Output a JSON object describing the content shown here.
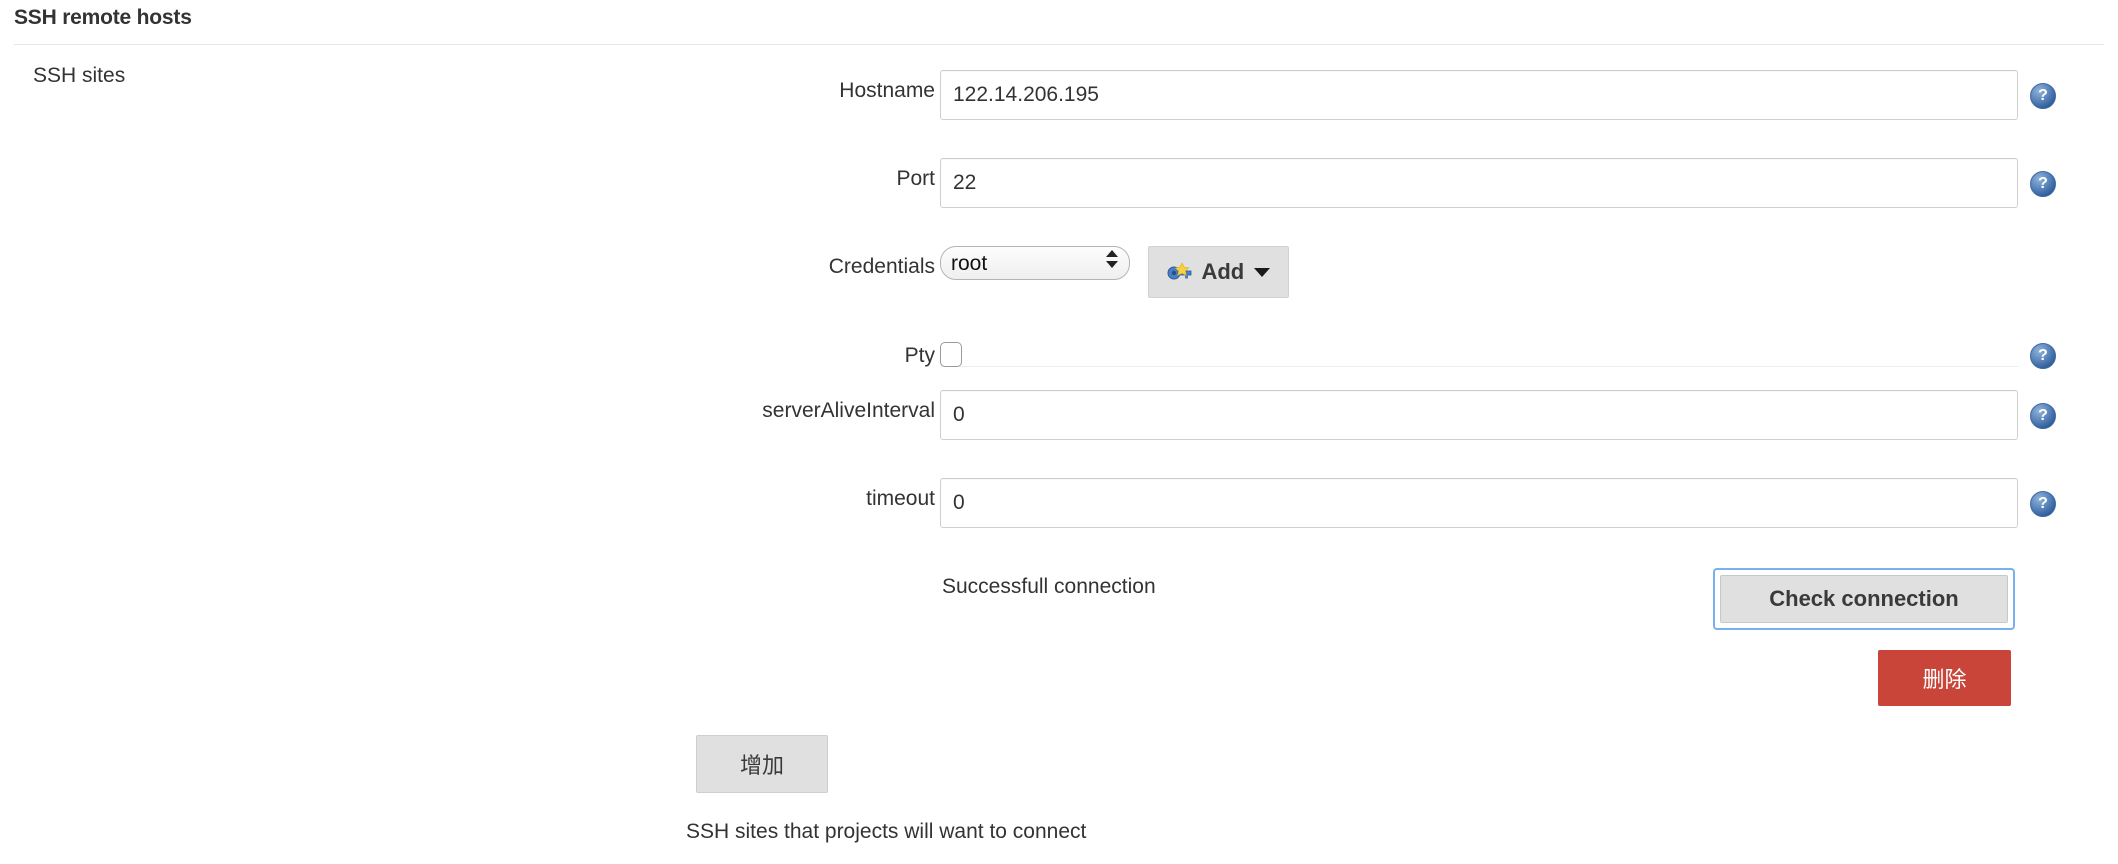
{
  "header": {
    "title": "SSH remote hosts"
  },
  "section": {
    "label": "SSH sites"
  },
  "colors": {
    "delete_button_bg": "#c9453a",
    "focus_ring": "#7ab0ef",
    "help_icon_blue": "#2f5c99",
    "button_bg": "#e0e0e0",
    "divider": "#e6e6e6"
  },
  "fields": {
    "hostname": {
      "label": "Hostname",
      "value": "122.14.206.195",
      "placeholder": "",
      "help_icon": "help-circle-icon"
    },
    "port": {
      "label": "Port",
      "value": "22",
      "placeholder": "",
      "help_icon": "help-circle-icon"
    },
    "credentials": {
      "label": "Credentials",
      "value": "root",
      "options": [
        "root"
      ],
      "add_button": {
        "label": "Add",
        "icon": "key-icon",
        "caret": "caret-down-icon"
      }
    },
    "pty": {
      "label": "Pty",
      "checked": false,
      "help_icon": "help-circle-icon"
    },
    "server_alive_interval": {
      "label": "serverAliveInterval",
      "value": "0",
      "placeholder": "",
      "help_icon": "help-circle-icon"
    },
    "timeout": {
      "label": "timeout",
      "value": "0",
      "placeholder": "",
      "help_icon": "help-circle-icon"
    }
  },
  "connection": {
    "status_text": "Successfull connection",
    "check_button_label": "Check connection"
  },
  "actions": {
    "delete_label": "删除",
    "add_site_label": "增加"
  },
  "footer": {
    "note": "SSH sites that projects will want to connect"
  }
}
